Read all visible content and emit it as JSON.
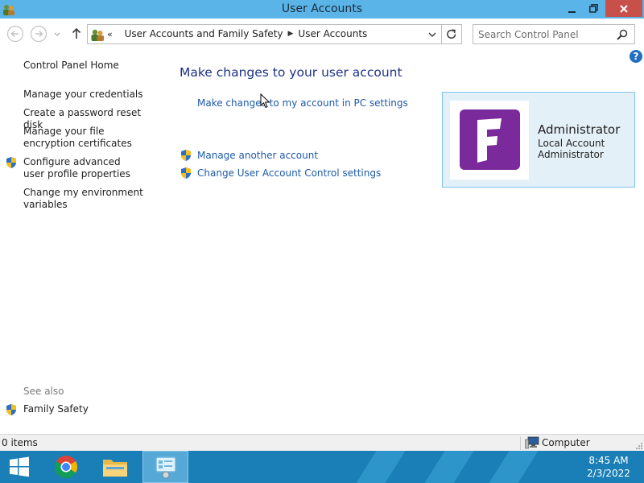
{
  "window": {
    "title": "User Accounts",
    "controls": {
      "minimize": "minimize-icon",
      "restore": "restore-icon",
      "close": "close-icon"
    }
  },
  "nav": {
    "breadcrumb_overflow": "«",
    "breadcrumbs": [
      "User Accounts and Family Safety",
      "User Accounts"
    ],
    "search_placeholder": "Search Control Panel"
  },
  "help_label": "?",
  "left_pane": {
    "home": "Control Panel Home",
    "links": [
      "Manage your credentials",
      "Create a password reset disk",
      "Manage your file encryption certificates",
      "Configure advanced user profile properties",
      "Change my environment variables"
    ],
    "see_also_heading": "See also",
    "see_also_links": [
      "Family Safety"
    ]
  },
  "main": {
    "title": "Make changes to your user account",
    "primary_link": "Make changes to my account in PC settings",
    "tasks": [
      "Manage another account",
      "Change User Account Control settings"
    ]
  },
  "account": {
    "name": "Administrator",
    "type": "Local Account",
    "role": "Administrator",
    "avatar_letter": "F",
    "avatar_color": "#7b2a9c"
  },
  "status_bar": {
    "items": "0 items",
    "location": "Computer"
  },
  "taskbar": {
    "time": "8:45 AM",
    "date": "2/3/2022",
    "color": "#1a7fb6"
  }
}
